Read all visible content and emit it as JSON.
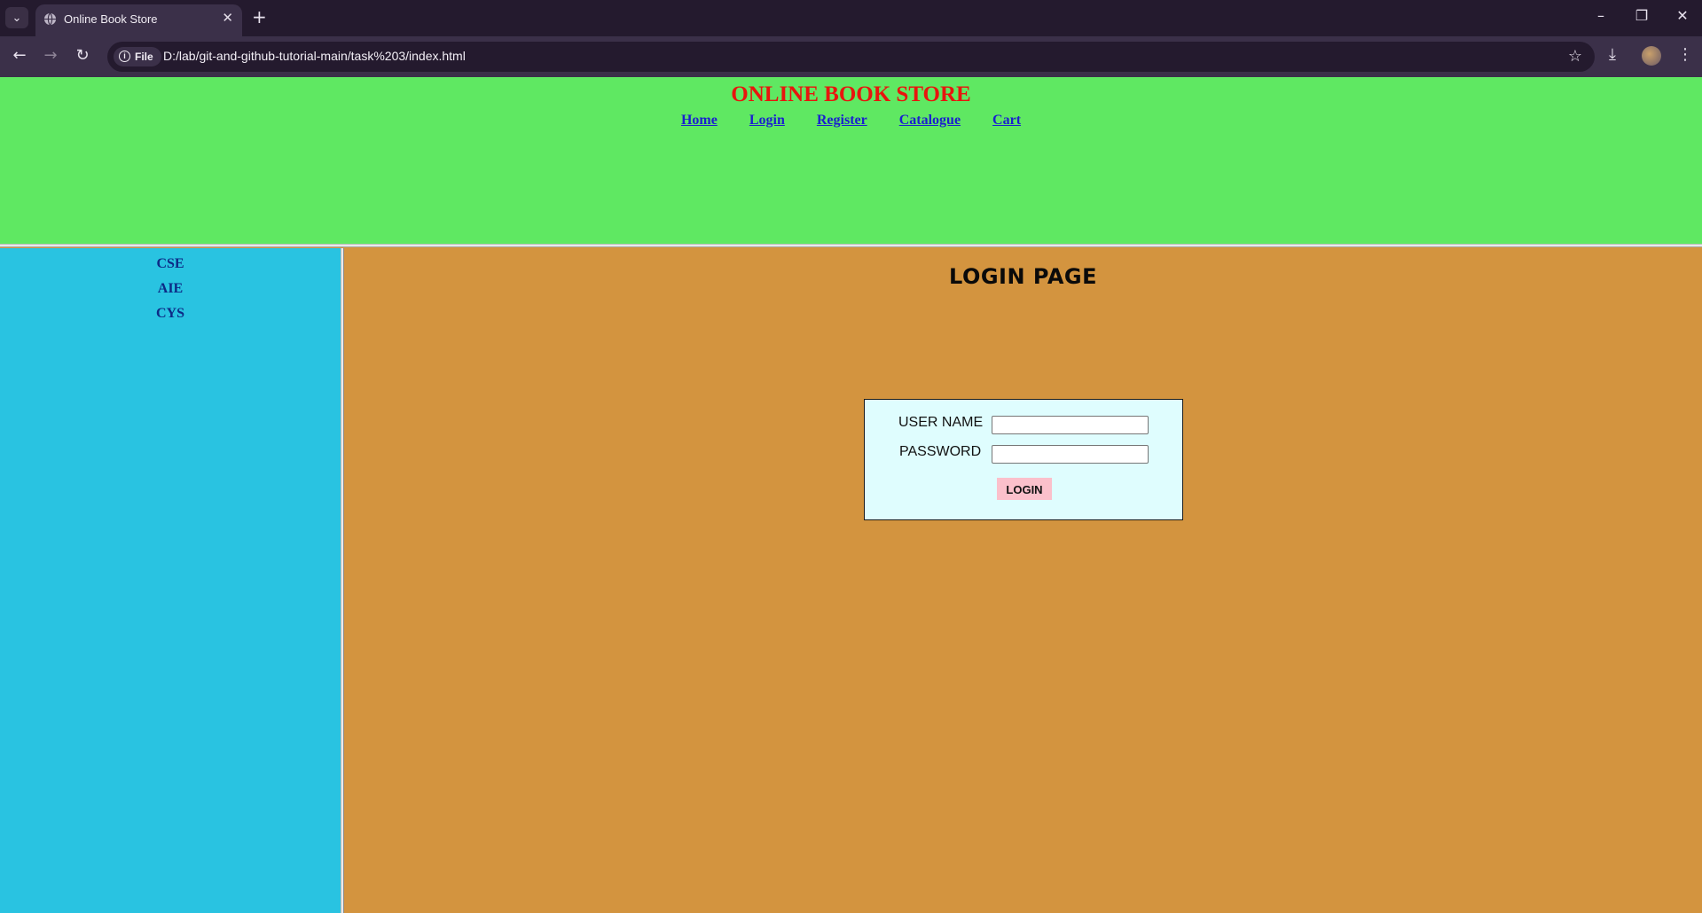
{
  "browser": {
    "tab_title": "Online Book Store",
    "file_chip": "File",
    "url": "D:/lab/git-and-github-tutorial-main/task%203/index.html"
  },
  "site": {
    "title": "ONLINE BOOK STORE",
    "nav": [
      "Home",
      "Login",
      "Register",
      "Catalogue",
      "Cart"
    ]
  },
  "sidebar": {
    "items": [
      "CSE",
      "AIE",
      "CYS"
    ]
  },
  "login": {
    "heading": "LOGIN PAGE",
    "username_label": "USER NAME",
    "username_value": "",
    "password_label": "PASSWORD",
    "password_value": "",
    "button_label": "LOGIN"
  },
  "colors": {
    "header_bg": "#5fe862",
    "title_color": "#e8150e",
    "link_color": "#1a1fcf",
    "sidebar_bg": "#29c3e1",
    "main_bg": "#d3943f",
    "login_box_bg": "#dffdfe",
    "button_bg": "#fbc0cb"
  }
}
